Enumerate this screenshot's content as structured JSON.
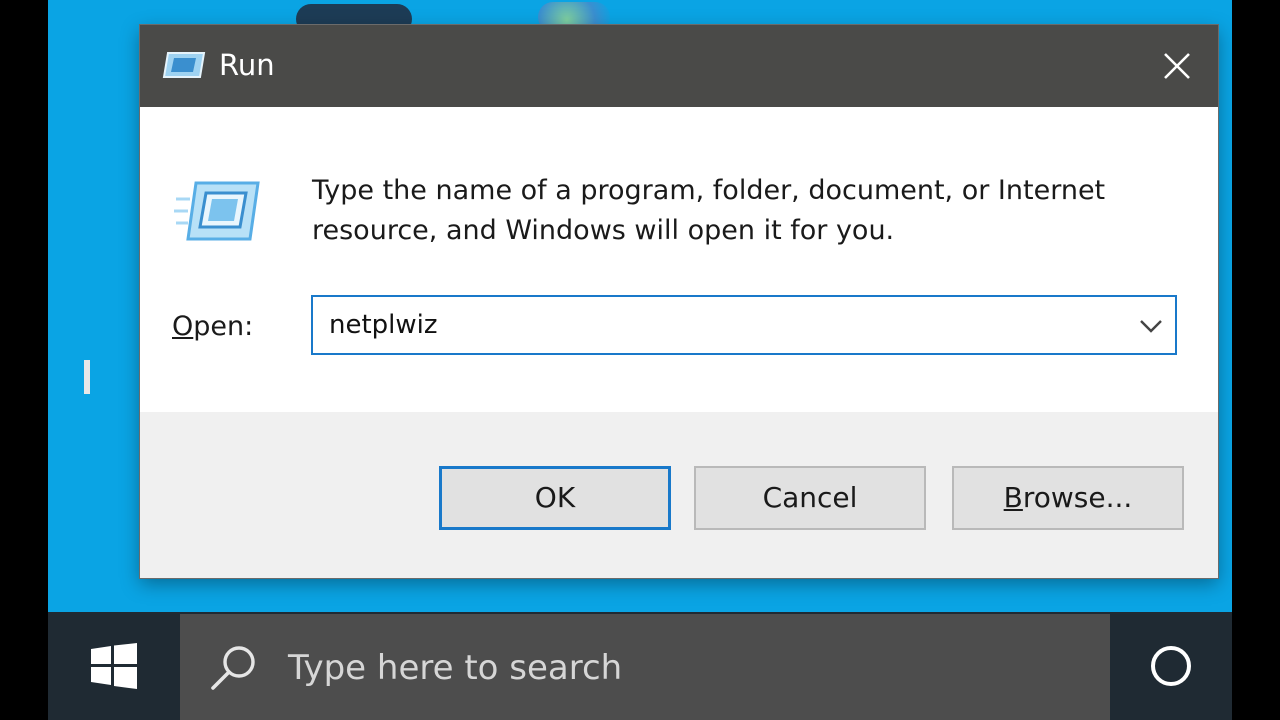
{
  "dialog": {
    "title": "Run",
    "close_icon": "close-icon",
    "description": "Type the name of a program, folder, document, or Internet resource, and Windows will open it for you.",
    "open_label_accel": "O",
    "open_label_rest": "pen:",
    "open_value": "netplwiz",
    "buttons": {
      "ok": "OK",
      "cancel": "Cancel",
      "browse_accel": "B",
      "browse_rest": "rowse..."
    }
  },
  "taskbar": {
    "start_icon": "windows-logo-icon",
    "search_placeholder": "Type here to search",
    "search_icon": "search-icon",
    "cortana_icon": "cortana-circle-icon"
  },
  "colors": {
    "desktop": "#0aa4e4",
    "titlebar": "#4a4a48",
    "accent": "#1979ca",
    "taskbar": "#1f2a33",
    "searchbox": "#4d4d4d"
  }
}
